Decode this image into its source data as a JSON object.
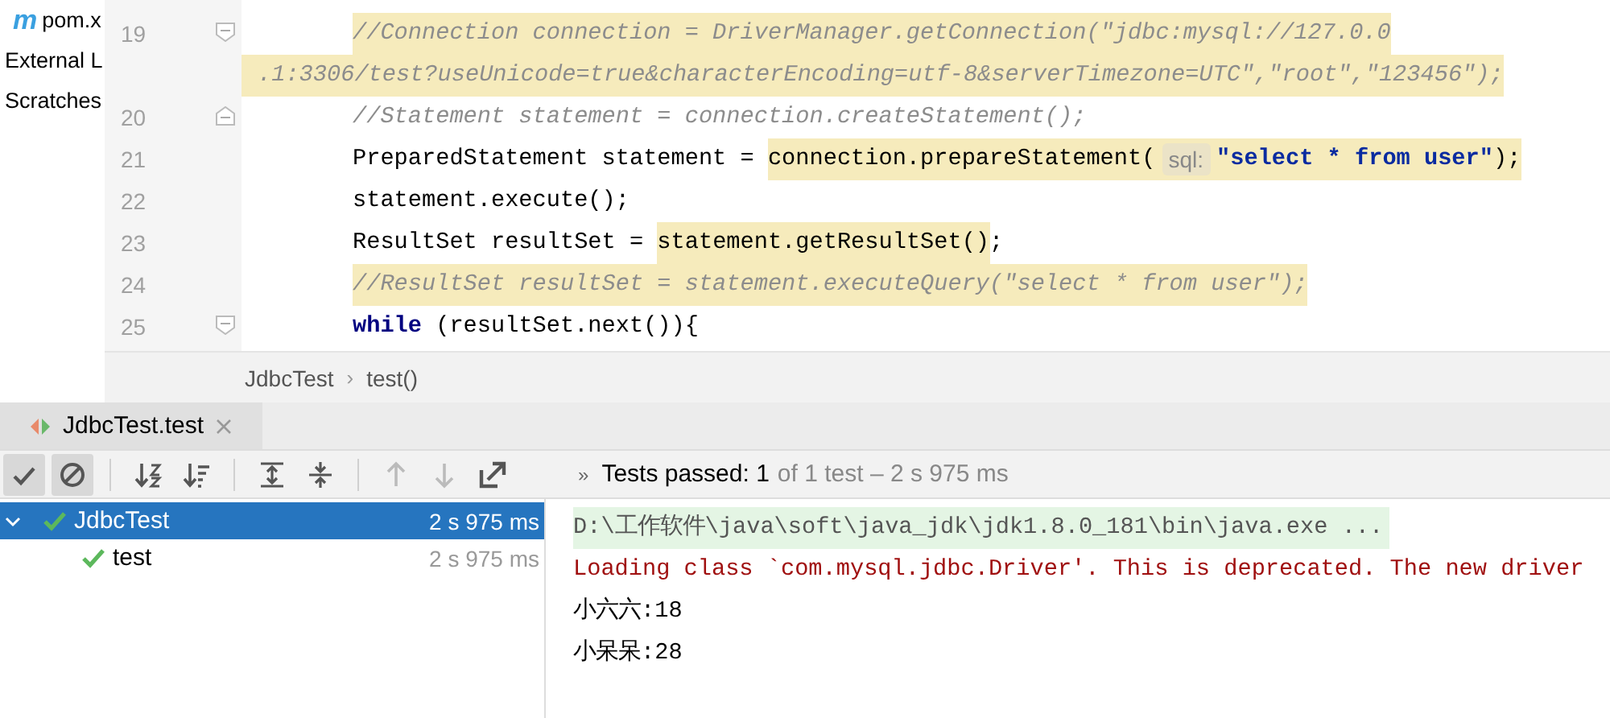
{
  "project_panel": {
    "items": [
      {
        "label": "pom.x",
        "icon_text": "m"
      },
      {
        "label": "External L"
      },
      {
        "label": "Scratches"
      }
    ]
  },
  "editor": {
    "lines": [
      {
        "kind": "code",
        "number": "19",
        "fold_start": true,
        "segments": [
          {
            "kind": "comment",
            "highlighted": true,
            "text": "//Connection connection = DriverManager.getConnection(\"jdbc:mysql://127.0.0"
          }
        ]
      },
      {
        "kind": "wrap",
        "segments": [
          {
            "kind": "comment",
            "highlighted": true,
            "text": ".1:3306/test?useUnicode=true&characterEncoding=utf-8&serverTimezone=UTC\",\"root\",\"123456\");"
          }
        ]
      },
      {
        "kind": "code",
        "number": "20",
        "fold_end": true,
        "segments": [
          {
            "kind": "comment",
            "highlighted": false,
            "text": "//Statement statement = connection.createStatement();"
          }
        ]
      },
      {
        "kind": "code",
        "number": "21",
        "segments": [
          {
            "kind": "plain",
            "highlighted": false,
            "text": "PreparedStatement statement = "
          },
          {
            "kind": "plain",
            "highlighted": true,
            "text": "connection.prepareStatement("
          },
          {
            "kind": "hint",
            "highlighted": true,
            "text": "sql:"
          },
          {
            "kind": "string",
            "highlighted": true,
            "text": "\"select * from user\""
          },
          {
            "kind": "plain",
            "highlighted": true,
            "text": ");"
          }
        ]
      },
      {
        "kind": "code",
        "number": "22",
        "segments": [
          {
            "kind": "plain",
            "highlighted": false,
            "text": "statement.execute();"
          }
        ]
      },
      {
        "kind": "code",
        "number": "23",
        "segments": [
          {
            "kind": "plain",
            "highlighted": false,
            "text": "ResultSet resultSet = "
          },
          {
            "kind": "plain",
            "highlighted": true,
            "text": "statement.getResultSet()"
          },
          {
            "kind": "plain",
            "highlighted": false,
            "text": ";"
          }
        ]
      },
      {
        "kind": "code",
        "number": "24",
        "segments": [
          {
            "kind": "comment",
            "highlighted": true,
            "text": "//ResultSet resultSet = statement.executeQuery(\"select * from user\");"
          }
        ]
      },
      {
        "kind": "code",
        "number": "25",
        "fold_start": true,
        "segments": [
          {
            "kind": "keyword",
            "highlighted": false,
            "text": "while"
          },
          {
            "kind": "plain",
            "highlighted": false,
            "text": " (resultSet.next()){"
          }
        ]
      }
    ]
  },
  "breadcrumb": {
    "separator": "›",
    "items": [
      {
        "label": "JdbcTest"
      },
      {
        "label": "test()"
      }
    ]
  },
  "run_panel": {
    "tabs": [
      {
        "label": "JdbcTest.test",
        "selected": true,
        "closable": true
      }
    ],
    "toolbar": {
      "buttons": [
        {
          "kind": "show-passed",
          "on": true
        },
        {
          "kind": "show-ignored",
          "on": true
        },
        {
          "kind": "sort-alpha",
          "on": false
        },
        {
          "kind": "sort-duration",
          "on": false
        },
        {
          "kind": "expand-all",
          "on": false
        },
        {
          "kind": "collapse-all",
          "on": false
        },
        {
          "kind": "previous",
          "on": false
        },
        {
          "kind": "next",
          "on": false
        },
        {
          "kind": "export",
          "on": false
        }
      ],
      "overflow": "»",
      "status": "Tests passed: 1",
      "status_detail": "of 1 test – 2 s 975 ms"
    },
    "tree": [
      {
        "label": "JdbcTest",
        "time": "2 s 975 ms",
        "passed": true,
        "selected": true,
        "expanded": true,
        "children": [
          {
            "label": "test",
            "time": "2 s 975 ms",
            "passed": true,
            "selected": false
          }
        ]
      }
    ],
    "console": [
      {
        "kind": "command",
        "text": "D:\\工作软件\\java\\soft\\java_jdk\\jdk1.8.0_181\\bin\\java.exe ..."
      },
      {
        "kind": "stderr",
        "text": "Loading class `com.mysql.jdbc.Driver'. This is deprecated. The new driver"
      },
      {
        "kind": "stdout",
        "text": "小六六:18"
      },
      {
        "kind": "stdout",
        "text": "小呆呆:28"
      }
    ]
  }
}
